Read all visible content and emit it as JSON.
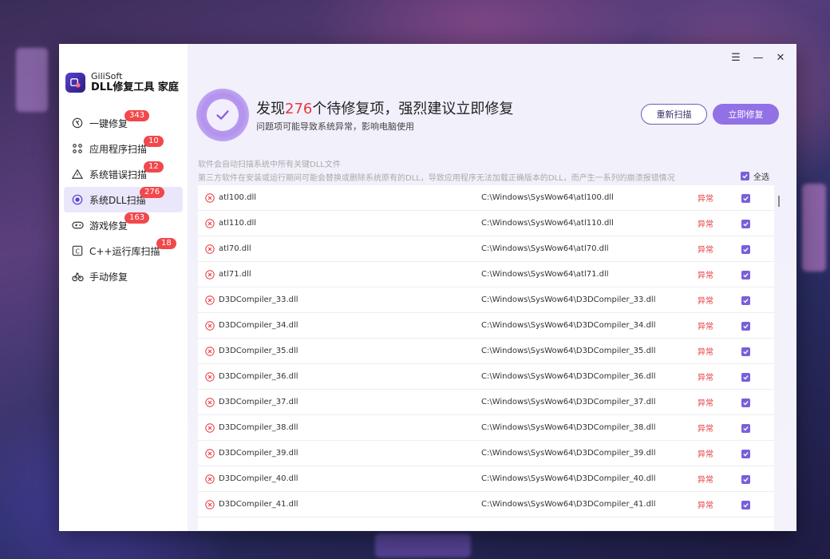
{
  "app": {
    "brand_sub": "GiliSoft",
    "brand_title": "DLL修复工具 家庭"
  },
  "sidebar": {
    "items": [
      {
        "label": "一键修复",
        "badge": "343",
        "icon": "wrench-circle-icon"
      },
      {
        "label": "应用程序扫描",
        "badge": "10",
        "icon": "apps-grid-icon"
      },
      {
        "label": "系统错误扫描",
        "badge": "12",
        "icon": "warning-triangle-icon"
      },
      {
        "label": "系统DLL扫描",
        "badge": "276",
        "icon": "scan-target-icon",
        "active": true
      },
      {
        "label": "游戏修复",
        "badge": "163",
        "icon": "gamepad-icon"
      },
      {
        "label": "C++运行库扫描",
        "badge": "18",
        "icon": "cpp-icon"
      },
      {
        "label": "手动修复",
        "badge": "",
        "icon": "bike-tool-icon"
      }
    ]
  },
  "window_controls": {
    "menu": "☰",
    "minimize": "—",
    "close": "✕"
  },
  "hero": {
    "title_prefix": "发现",
    "count": "276",
    "title_suffix": "个待修复项，强烈建议立即修复",
    "subtitle": "问题项可能导致系统异常，影响电脑使用"
  },
  "buttons": {
    "rescan": "重新扫描",
    "fix_now": "立即修复"
  },
  "description": {
    "line1": "软件会自动扫描系统中所有关键DLL文件",
    "line2": "第三方软件在安装或运行期间可能会替换或删除系统原有的DLL，导致应用程序无法加载正确版本的DLL，而产生一系列的崩溃报错情况"
  },
  "select_all_label": "全选",
  "table": {
    "rows": [
      {
        "name": "atl100.dll",
        "path": "C:\\Windows\\SysWow64\\atl100.dll",
        "status": "异常"
      },
      {
        "name": "atl110.dll",
        "path": "C:\\Windows\\SysWow64\\atl110.dll",
        "status": "异常"
      },
      {
        "name": "atl70.dll",
        "path": "C:\\Windows\\SysWow64\\atl70.dll",
        "status": "异常"
      },
      {
        "name": "atl71.dll",
        "path": "C:\\Windows\\SysWow64\\atl71.dll",
        "status": "异常"
      },
      {
        "name": "D3DCompiler_33.dll",
        "path": "C:\\Windows\\SysWow64\\D3DCompiler_33.dll",
        "status": "异常"
      },
      {
        "name": "D3DCompiler_34.dll",
        "path": "C:\\Windows\\SysWow64\\D3DCompiler_34.dll",
        "status": "异常"
      },
      {
        "name": "D3DCompiler_35.dll",
        "path": "C:\\Windows\\SysWow64\\D3DCompiler_35.dll",
        "status": "异常"
      },
      {
        "name": "D3DCompiler_36.dll",
        "path": "C:\\Windows\\SysWow64\\D3DCompiler_36.dll",
        "status": "异常"
      },
      {
        "name": "D3DCompiler_37.dll",
        "path": "C:\\Windows\\SysWow64\\D3DCompiler_37.dll",
        "status": "异常"
      },
      {
        "name": "D3DCompiler_38.dll",
        "path": "C:\\Windows\\SysWow64\\D3DCompiler_38.dll",
        "status": "异常"
      },
      {
        "name": "D3DCompiler_39.dll",
        "path": "C:\\Windows\\SysWow64\\D3DCompiler_39.dll",
        "status": "异常"
      },
      {
        "name": "D3DCompiler_40.dll",
        "path": "C:\\Windows\\SysWow64\\D3DCompiler_40.dll",
        "status": "异常"
      },
      {
        "name": "D3DCompiler_41.dll",
        "path": "C:\\Windows\\SysWow64\\D3DCompiler_41.dll",
        "status": "异常"
      }
    ]
  },
  "colors": {
    "accent": "#9270e6",
    "error": "#e5393d",
    "badge": "#f2484b",
    "active_bg": "#ebe7fb"
  }
}
